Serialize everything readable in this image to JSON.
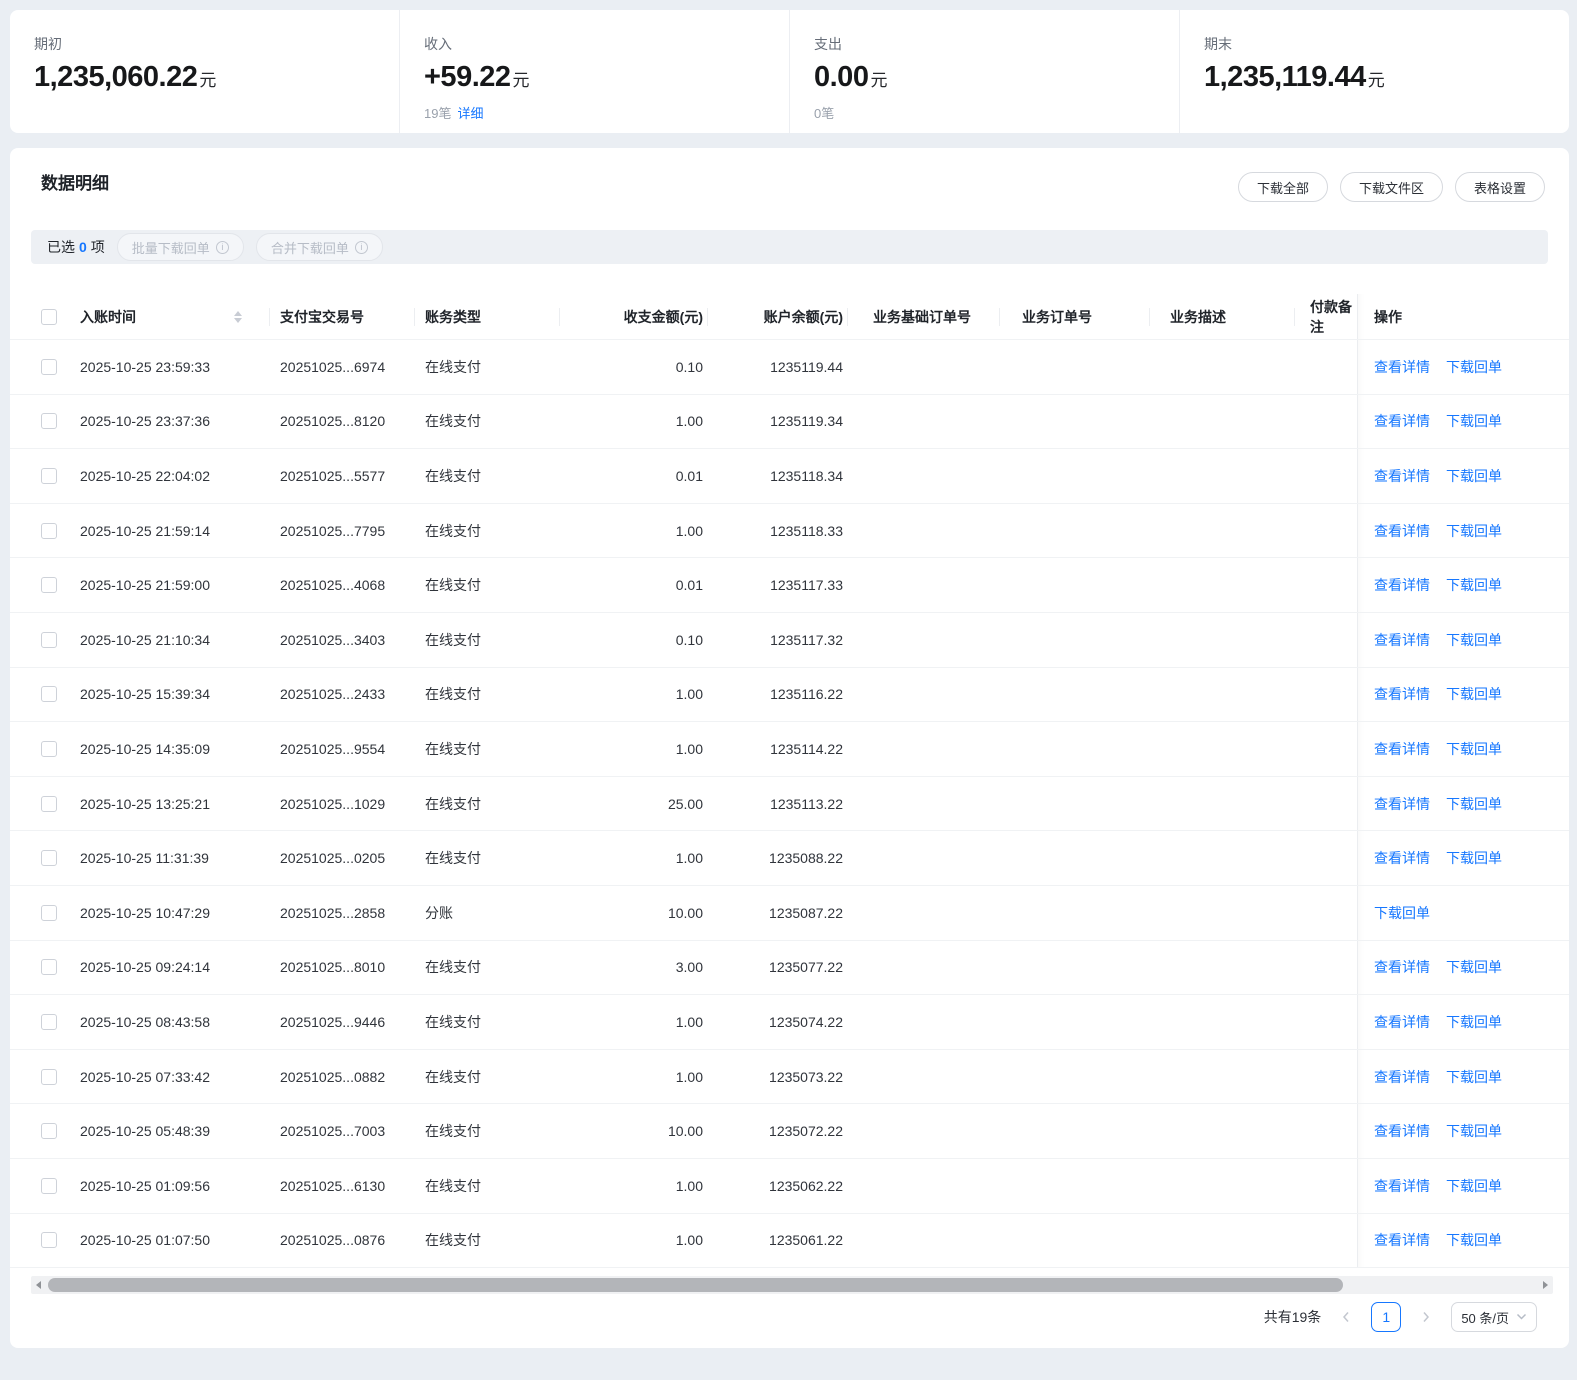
{
  "colors": {
    "accent": "#1677ff",
    "page_background": "#eaeef3"
  },
  "summary": {
    "opening": {
      "label": "期初",
      "value": "1,235,060.22",
      "unit": "元"
    },
    "income": {
      "label": "收入",
      "value": "+59.22",
      "unit": "元",
      "count": "19笔",
      "detail_link": "详细"
    },
    "expense": {
      "label": "支出",
      "value": "0.00",
      "unit": "元",
      "count": "0笔"
    },
    "closing": {
      "label": "期末",
      "value": "1,235,119.44",
      "unit": "元"
    }
  },
  "panel": {
    "title": "数据明细",
    "toolbar_buttons": [
      "下载全部",
      "下载文件区",
      "表格设置"
    ],
    "selection": {
      "prefix": "已选",
      "count": "0",
      "suffix": "项",
      "buttons": [
        "批量下载回单",
        "合并下载回单"
      ]
    }
  },
  "table": {
    "columns": [
      "入账时间",
      "支付宝交易号",
      "账务类型",
      "收支金额(元)",
      "账户余额(元)",
      "业务基础订单号",
      "业务订单号",
      "业务描述",
      "付款备注",
      "操作"
    ],
    "action_labels": {
      "detail": "查看详情",
      "download": "下载回单"
    },
    "rows": [
      {
        "time": "2025-10-25 23:59:33",
        "txn": "20251025...6974",
        "type": "在线支付",
        "amount": "0.10",
        "balance": "1235119.44",
        "actions": [
          "查看详情",
          "下载回单"
        ]
      },
      {
        "time": "2025-10-25 23:37:36",
        "txn": "20251025...8120",
        "type": "在线支付",
        "amount": "1.00",
        "balance": "1235119.34",
        "actions": [
          "查看详情",
          "下载回单"
        ]
      },
      {
        "time": "2025-10-25 22:04:02",
        "txn": "20251025...5577",
        "type": "在线支付",
        "amount": "0.01",
        "balance": "1235118.34",
        "actions": [
          "查看详情",
          "下载回单"
        ]
      },
      {
        "time": "2025-10-25 21:59:14",
        "txn": "20251025...7795",
        "type": "在线支付",
        "amount": "1.00",
        "balance": "1235118.33",
        "actions": [
          "查看详情",
          "下载回单"
        ]
      },
      {
        "time": "2025-10-25 21:59:00",
        "txn": "20251025...4068",
        "type": "在线支付",
        "amount": "0.01",
        "balance": "1235117.33",
        "actions": [
          "查看详情",
          "下载回单"
        ]
      },
      {
        "time": "2025-10-25 21:10:34",
        "txn": "20251025...3403",
        "type": "在线支付",
        "amount": "0.10",
        "balance": "1235117.32",
        "actions": [
          "查看详情",
          "下载回单"
        ]
      },
      {
        "time": "2025-10-25 15:39:34",
        "txn": "20251025...2433",
        "type": "在线支付",
        "amount": "1.00",
        "balance": "1235116.22",
        "actions": [
          "查看详情",
          "下载回单"
        ]
      },
      {
        "time": "2025-10-25 14:35:09",
        "txn": "20251025...9554",
        "type": "在线支付",
        "amount": "1.00",
        "balance": "1235114.22",
        "actions": [
          "查看详情",
          "下载回单"
        ]
      },
      {
        "time": "2025-10-25 13:25:21",
        "txn": "20251025...1029",
        "type": "在线支付",
        "amount": "25.00",
        "balance": "1235113.22",
        "actions": [
          "查看详情",
          "下载回单"
        ]
      },
      {
        "time": "2025-10-25 11:31:39",
        "txn": "20251025...0205",
        "type": "在线支付",
        "amount": "1.00",
        "balance": "1235088.22",
        "actions": [
          "查看详情",
          "下载回单"
        ]
      },
      {
        "time": "2025-10-25 10:47:29",
        "txn": "20251025...2858",
        "type": "分账",
        "amount": "10.00",
        "balance": "1235087.22",
        "actions": [
          "下载回单"
        ]
      },
      {
        "time": "2025-10-25 09:24:14",
        "txn": "20251025...8010",
        "type": "在线支付",
        "amount": "3.00",
        "balance": "1235077.22",
        "actions": [
          "查看详情",
          "下载回单"
        ]
      },
      {
        "time": "2025-10-25 08:43:58",
        "txn": "20251025...9446",
        "type": "在线支付",
        "amount": "1.00",
        "balance": "1235074.22",
        "actions": [
          "查看详情",
          "下载回单"
        ]
      },
      {
        "time": "2025-10-25 07:33:42",
        "txn": "20251025...0882",
        "type": "在线支付",
        "amount": "1.00",
        "balance": "1235073.22",
        "actions": [
          "查看详情",
          "下载回单"
        ]
      },
      {
        "time": "2025-10-25 05:48:39",
        "txn": "20251025...7003",
        "type": "在线支付",
        "amount": "10.00",
        "balance": "1235072.22",
        "actions": [
          "查看详情",
          "下载回单"
        ]
      },
      {
        "time": "2025-10-25 01:09:56",
        "txn": "20251025...6130",
        "type": "在线支付",
        "amount": "1.00",
        "balance": "1235062.22",
        "actions": [
          "查看详情",
          "下载回单"
        ]
      },
      {
        "time": "2025-10-25 01:07:50",
        "txn": "20251025...0876",
        "type": "在线支付",
        "amount": "1.00",
        "balance": "1235061.22",
        "actions": [
          "查看详情",
          "下载回单"
        ]
      }
    ]
  },
  "pagination": {
    "total": "共有19条",
    "page": "1",
    "page_size": "50 条/页"
  }
}
